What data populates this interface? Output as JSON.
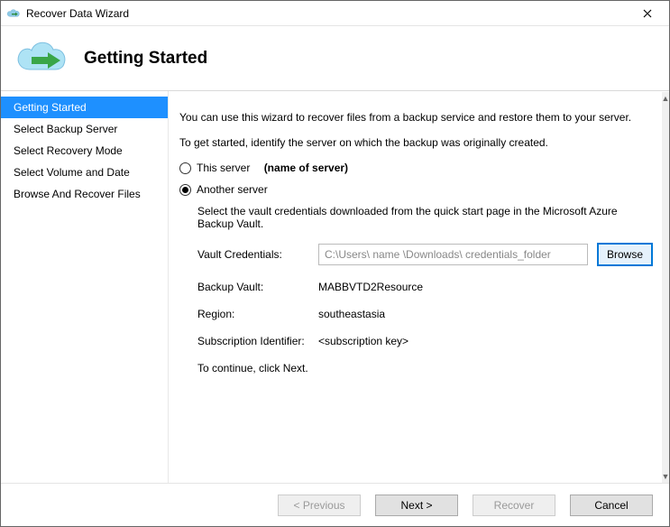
{
  "window": {
    "title": "Recover Data Wizard"
  },
  "header": {
    "title": "Getting Started"
  },
  "sidebar": {
    "steps": [
      "Getting Started",
      "Select Backup Server",
      "Select Recovery Mode",
      "Select Volume and Date",
      "Browse And Recover Files"
    ],
    "active_index": 0
  },
  "content": {
    "intro": "You can use this wizard to recover files from a backup service and restore them to your server.",
    "identify_server": "To get started, identify the server on which the backup was originally created.",
    "radio_this_server_label": "This server",
    "radio_this_server_detail": "(name of server)",
    "radio_another_server_label": "Another server",
    "selected_radio": "another",
    "vault_help": "Select the vault credentials downloaded from the quick start page in the Microsoft Azure Backup Vault.",
    "vault_credentials_label": "Vault Credentials:",
    "vault_credentials_value": "C:\\Users\\ name \\Downloads\\ credentials_folder",
    "browse_label": "Browse",
    "backup_vault_label": "Backup Vault:",
    "backup_vault_value": "MABBVTD2Resource",
    "region_label": "Region:",
    "region_value": "southeastasia",
    "subscription_label": "Subscription Identifier:",
    "subscription_value": "<subscription key>",
    "continue_text": "To continue, click Next."
  },
  "footer": {
    "previous": "< Previous",
    "next": "Next >",
    "recover": "Recover",
    "cancel": "Cancel"
  }
}
